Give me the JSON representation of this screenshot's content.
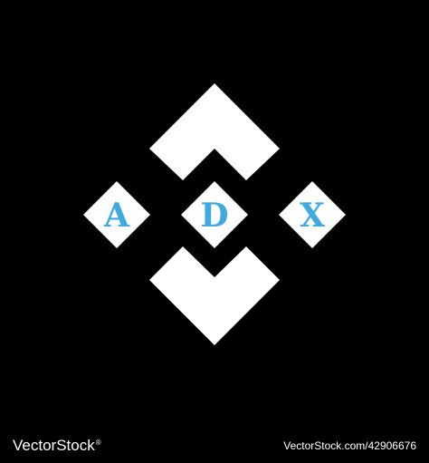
{
  "logo": {
    "letters": [
      "A",
      "D",
      "X"
    ],
    "letter_color": "#3fa9e0",
    "shape_color": "#ffffff",
    "background_color": "#000000"
  },
  "footer": {
    "brand": "VectorStock",
    "reg_mark": "®",
    "url": "VectorStock.com/42906676"
  }
}
